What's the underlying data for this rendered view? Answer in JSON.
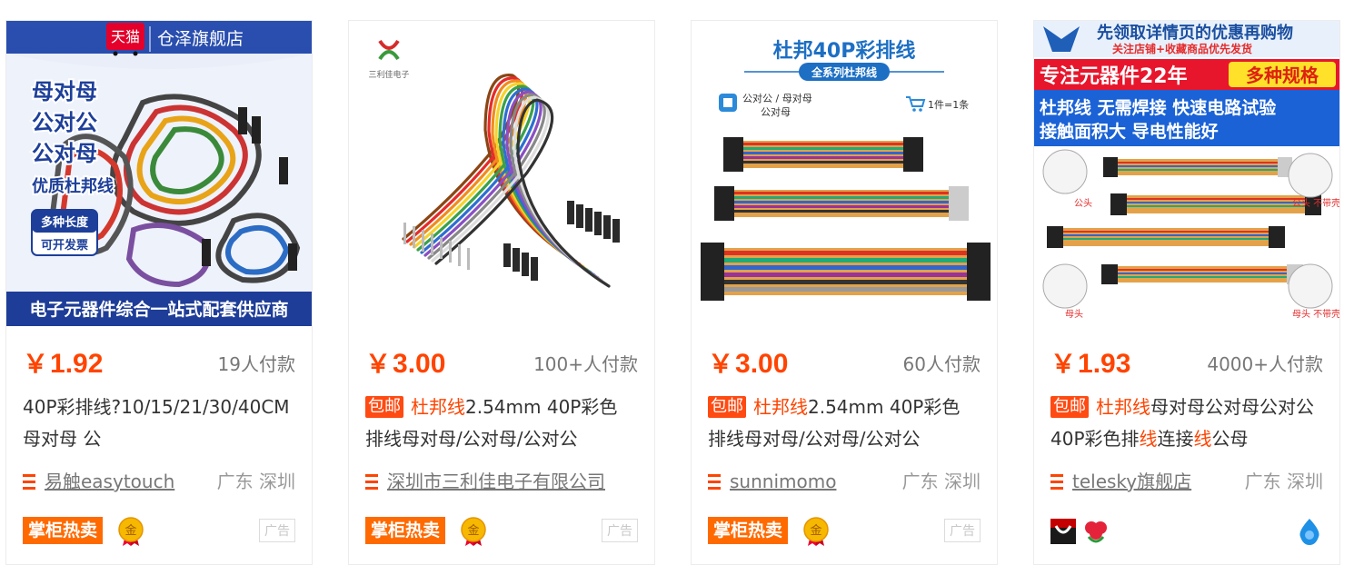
{
  "products": [
    {
      "image": {
        "tmall_badge": "天猫",
        "store_banner": "仓泽旗舰店",
        "lines": [
          "母对母",
          "公对公",
          "公对母",
          "优质杜邦线"
        ],
        "tag_lines": [
          "多种长度",
          "可开发票"
        ],
        "footer": "电子元器件综合一站式配套供应商"
      },
      "currency": "￥",
      "price": "1.92",
      "sold": "19人付款",
      "title_rest": "40P彩排线?10/15/21/30/40CM 母对母 公",
      "shop": "易触easytouch",
      "location": "广东 深圳",
      "hot_label": "掌柜热卖",
      "gold_label": "金",
      "ad_label": "广告"
    },
    {
      "image": {
        "brand": "三利佳电子"
      },
      "currency": "￥",
      "price": "3.00",
      "sold": "100+人付款",
      "baoyou": "包邮",
      "title_hl": "杜邦线",
      "title_rest": "2.54mm 40P彩色排线母对母/公对母/公对公",
      "shop": "深圳市三利佳电子有限公司",
      "location": "",
      "hot_label": "掌柜热卖",
      "gold_label": "金",
      "ad_label": "广告"
    },
    {
      "image": {
        "heading": "杜邦40P彩排线",
        "subheading": "全系列杜邦线",
        "types": [
          "公对公 / 母对母",
          "公对母"
        ],
        "unit": "1件=1条"
      },
      "currency": "￥",
      "price": "3.00",
      "sold": "60人付款",
      "baoyou": "包邮",
      "title_hl": "杜邦线",
      "title_rest": "2.54mm 40P彩色排线母对母/公对母/公对公",
      "shop": "sunnimomo",
      "location": "广东 深圳",
      "hot_label": "掌柜热卖",
      "gold_label": "金",
      "ad_label": "广告"
    },
    {
      "image": {
        "top_line": "先领取详情页的优惠再购物",
        "sub_line": "关注店铺+收藏商品优先发货",
        "banner_left": "专注元器件22年",
        "banner_right": "多种规格",
        "line1": "杜邦线 无需焊接 快速电路试验",
        "line2": "接触面积大 导电性能好",
        "label_male": "公头",
        "label_male_nohousing": "公头 不带壳",
        "label_female": "母头",
        "label_female_nohousing": "母头 不带壳"
      },
      "currency": "￥",
      "price": "1.93",
      "sold": "4000+人付款",
      "baoyou": "包邮",
      "title_hl": "杜邦线",
      "title_rest": "母对母公对母公对公40P彩色排",
      "title_hl2": "线",
      "title_rest2": "连接",
      "title_hl3": "线",
      "title_rest3": "公母",
      "shop": "telesky旗舰店",
      "location": "广东 深圳"
    }
  ],
  "colors": {
    "price": "#ff4400",
    "baoyou_bg": "#ff4a12",
    "hot_bg": "#ff6a00",
    "shop_icon": "#ff4400"
  }
}
